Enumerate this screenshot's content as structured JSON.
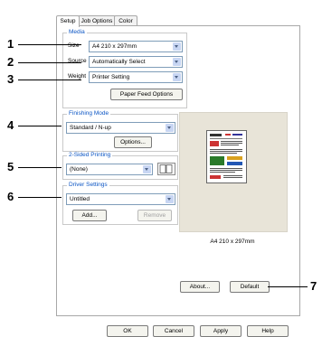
{
  "tabs": [
    "Setup",
    "Job Options",
    "Color"
  ],
  "media": {
    "title": "Media",
    "size_label": "Size",
    "size_value": "A4 210 x 297mm",
    "source_label": "Source",
    "source_value": "Automatically Select",
    "weight_label": "Weight",
    "weight_value": "Printer Setting",
    "paper_feed_button": "Paper Feed Options"
  },
  "finishing": {
    "title": "Finishing Mode",
    "value": "Standard / N-up",
    "options_button": "Options..."
  },
  "two_sided": {
    "title": "2-Sided Printing",
    "value": "(None)"
  },
  "driver_settings": {
    "title": "Driver Settings",
    "value": "Untitled",
    "add_button": "Add...",
    "remove_button": "Remove"
  },
  "preview": {
    "caption": "A4 210 x 297mm"
  },
  "buttons": {
    "about": "About...",
    "default": "Default",
    "ok": "OK",
    "cancel": "Cancel",
    "apply": "Apply",
    "help": "Help"
  },
  "callouts": [
    "1",
    "2",
    "3",
    "4",
    "5",
    "6",
    "7"
  ],
  "colors": {
    "group_title": "#0b55c4",
    "border": "#a8a8a8",
    "preview_bg": "#e8e4d8"
  }
}
